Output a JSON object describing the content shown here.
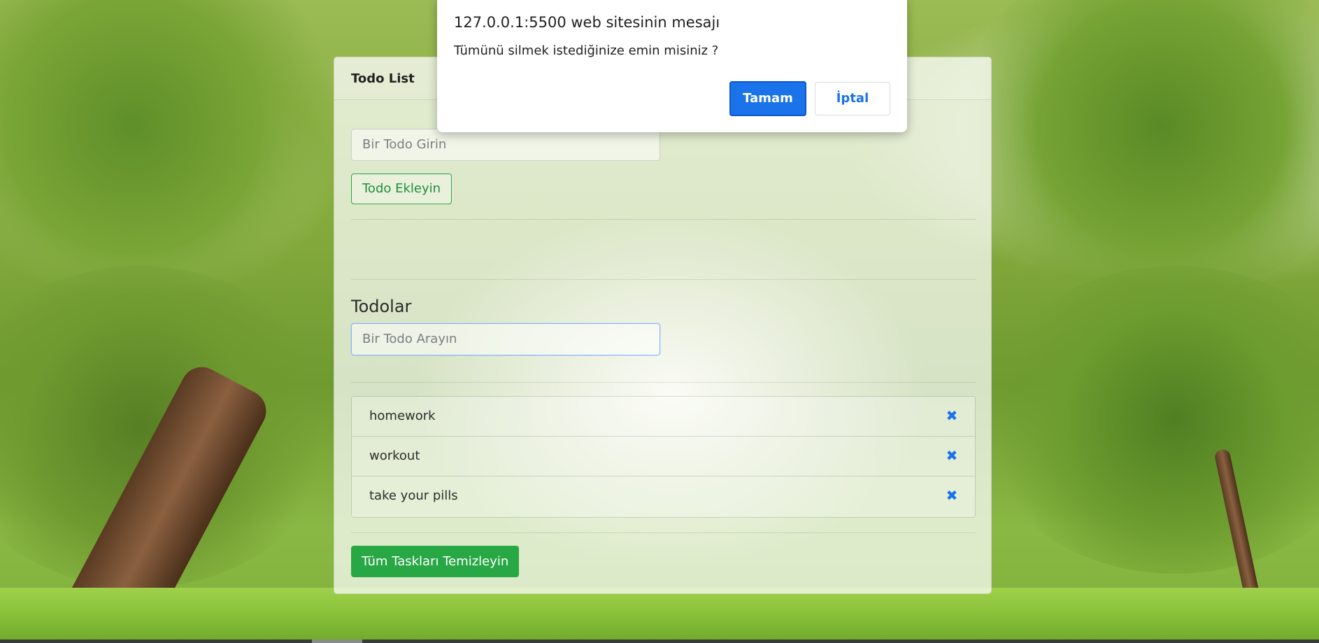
{
  "dialog": {
    "title": "127.0.0.1:5500 web sitesinin mesajı",
    "message": "Tümünü silmek istediğinize emin misiniz ?",
    "ok_label": "Tamam",
    "cancel_label": "İptal"
  },
  "card": {
    "title": "Todo List",
    "todo_input_placeholder": "Bir Todo Girin",
    "add_button_label": "Todo Ekleyin",
    "section_title": "Todolar",
    "search_placeholder": "Bir Todo Arayın",
    "todos": [
      {
        "text": "homework",
        "delete_icon": "close-icon"
      },
      {
        "text": "workout",
        "delete_icon": "close-icon"
      },
      {
        "text": "take your pills",
        "delete_icon": "close-icon"
      }
    ],
    "clear_button_label": "Tüm Taskları Temizleyin"
  },
  "colors": {
    "success": "#28a745",
    "primary": "#1a73e8",
    "focus_border": "#86b7fe"
  }
}
